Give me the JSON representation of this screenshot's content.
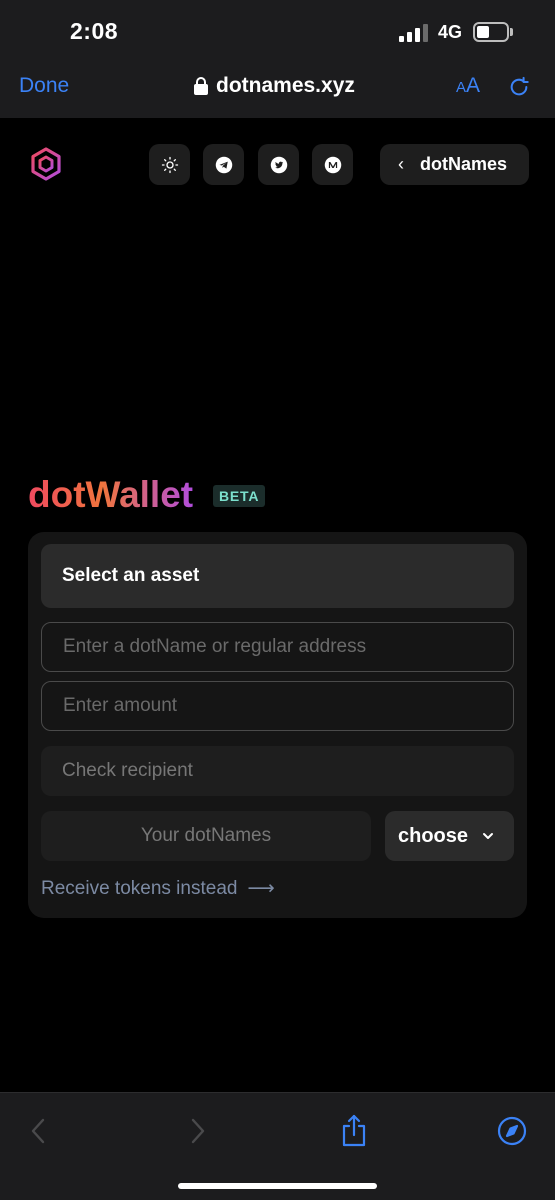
{
  "status_bar": {
    "time": "2:08",
    "network": "4G"
  },
  "browser": {
    "done_label": "Done",
    "url": "dotnames.xyz",
    "text_size_label_small": "A",
    "text_size_label_large": "A"
  },
  "site_nav": {
    "back_label": "dotNames",
    "icons": [
      "sun-icon",
      "telegram-icon",
      "twitter-icon",
      "medium-icon"
    ]
  },
  "wallet": {
    "title": "dotWallet",
    "badge": "BETA",
    "asset_select_label": "Select an asset",
    "recipient_placeholder": "Enter a dotName or regular address",
    "amount_placeholder": "Enter amount",
    "check_recipient_label": "Check recipient",
    "your_dotnames_label": "Your dotNames",
    "choose_label": "choose",
    "receive_link_label": "Receive tokens instead",
    "receive_arrow": "⟶"
  },
  "colors": {
    "accent_blue": "#3b82f6",
    "gradient_start": "#ef4a5f",
    "gradient_end": "#b14ddd",
    "beta_text": "#7ce0cd"
  }
}
